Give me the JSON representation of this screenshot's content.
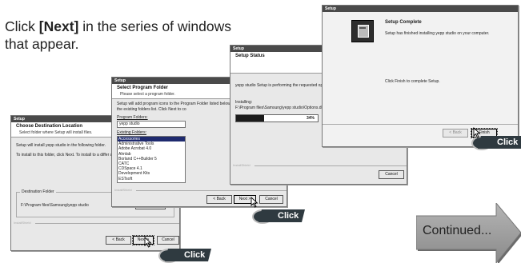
{
  "instruction": {
    "prefix": "Click ",
    "highlight": "[Next]",
    "suffix": " in the series of windows that appear."
  },
  "window1": {
    "titlebar": "Setup",
    "heading": "Choose Destination Location",
    "subheading": "Select folder where Setup will install files.",
    "line1": "Setup will install yepp studio in the following folder.",
    "line2": "To install to this folder, click Next. To install to a differ another folder.",
    "group_label": "Destination Folder",
    "folder_path": "F:\\Program files\\Samsung\\yepp studio",
    "browse_label": "Browse...",
    "brand": "InstallShield",
    "back_label": "< Back",
    "next_label": "Next >",
    "cancel_label": "Cancel"
  },
  "window2": {
    "titlebar": "Setup",
    "heading": "Select Program Folder",
    "subheading": "Please select a program folder.",
    "desc": "Setup will add program icons to the Program Folder listed below. name, or select one from the existing folders list. Click Next to co",
    "program_folders_label": "Program Folders:",
    "program_folder_value": "yepp studio",
    "existing_folders_label": "Existing Folders:",
    "folders": [
      "Accessories",
      "Administrative Tools",
      "Adobe Acrobat 4.0",
      "Ahnlab",
      "Borland C++Builder 5",
      "CATC",
      "CDSpace 4.1",
      "Development Kits",
      "ESTsoft"
    ],
    "brand": "InstallShield",
    "back_label": "< Back",
    "next_label": "Next >",
    "cancel_label": "Cancel"
  },
  "window3": {
    "titlebar": "Setup",
    "heading": "Setup Status",
    "status_text": "yepp studio Setup is performing the requested oper",
    "installing_label": "Installing:",
    "installing_path": "F:\\Program files\\Samsung\\yepp studio\\Options.dll",
    "progress_percent": 34,
    "progress_text": "34%",
    "brand": "InstallShield",
    "cancel_label": "Cancel"
  },
  "window4": {
    "titlebar": "Setup",
    "heading": "Setup Complete",
    "desc": "Setup has finished installing yepp studio on your computer.",
    "finish_prompt": "Click Finish to complete Setup.",
    "back_label": "< Back",
    "finish_label": "Finish"
  },
  "click_label": "Click",
  "continued_label": "Continued..."
}
